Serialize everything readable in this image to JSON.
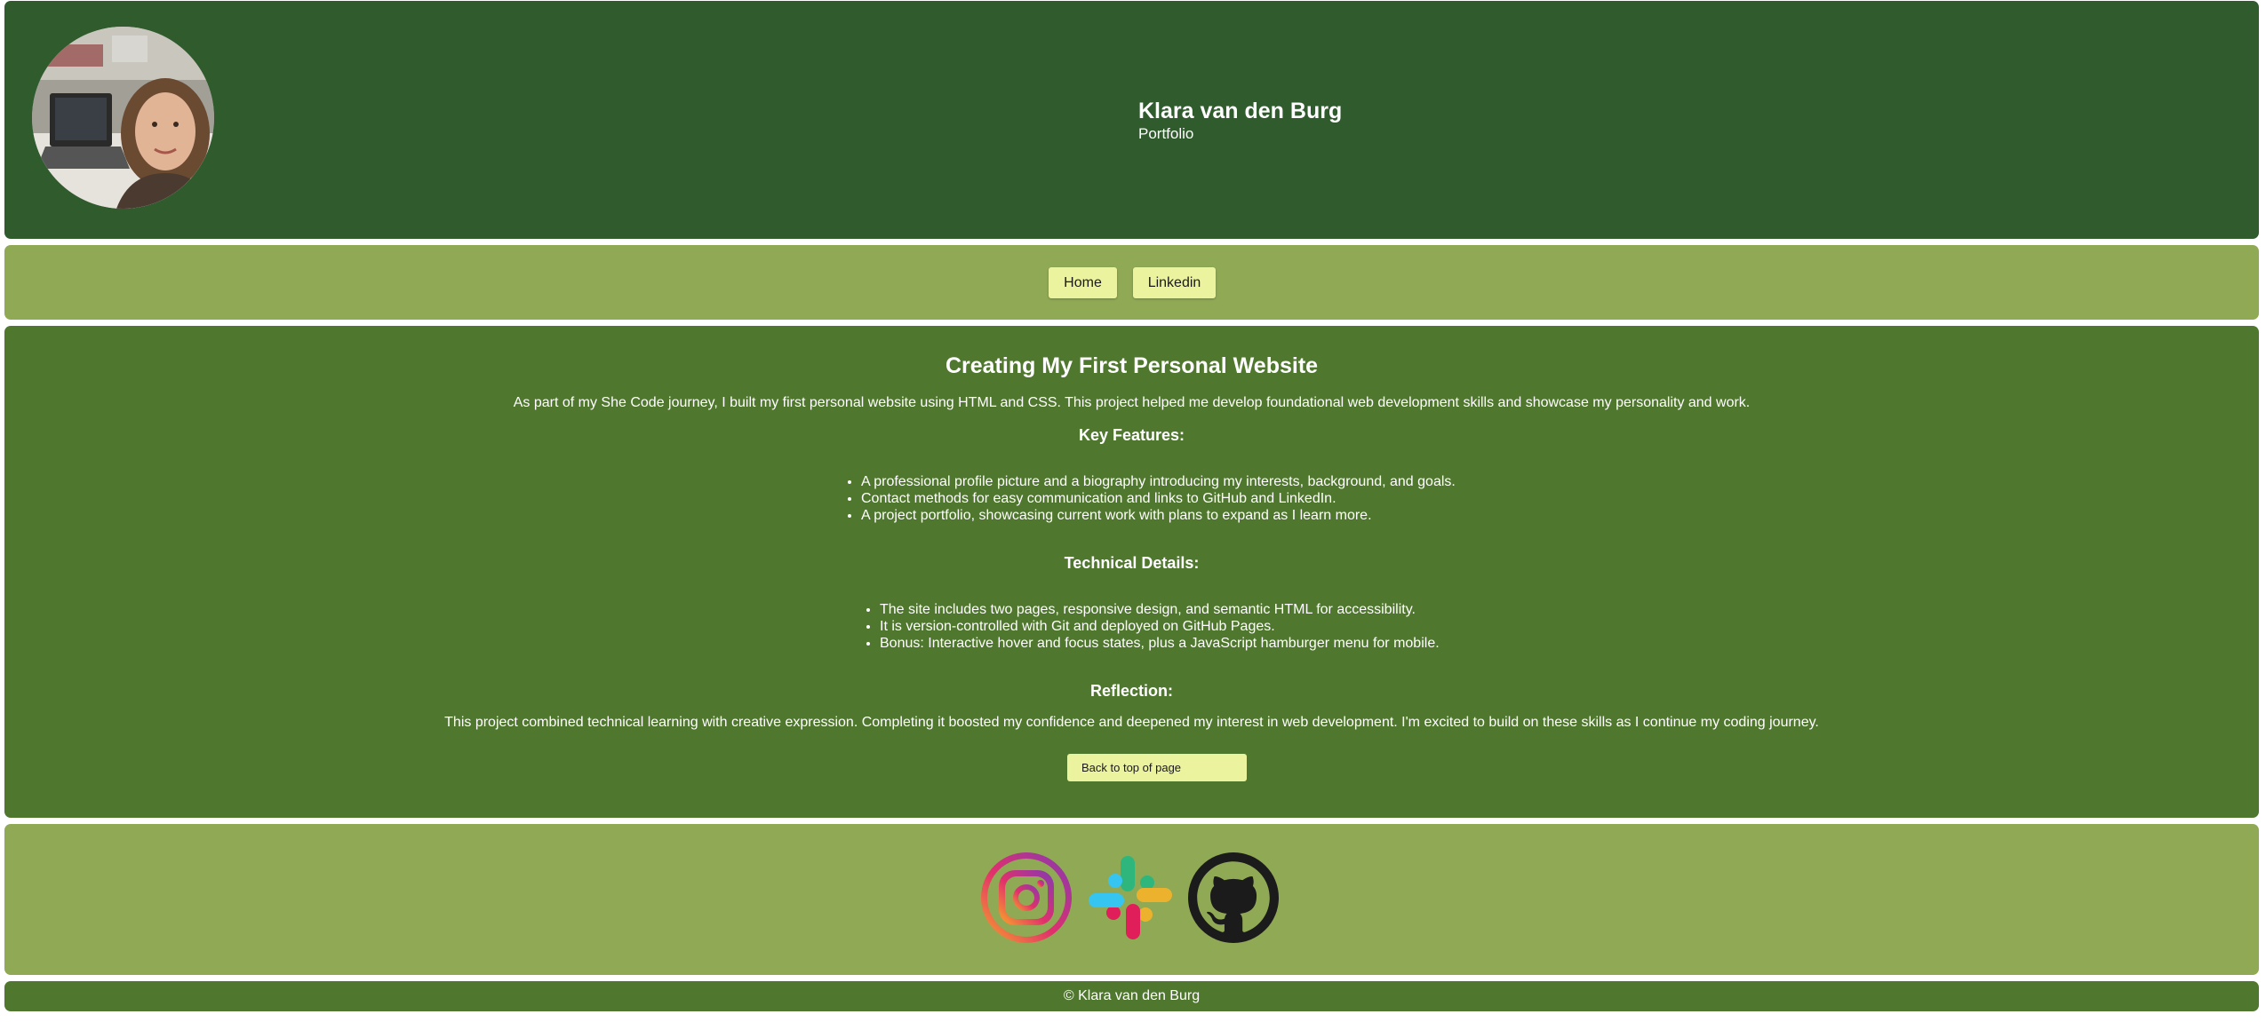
{
  "header": {
    "avatar_alt": "Profile picture",
    "name": "Klara van den Burg",
    "subtitle": "Portfolio"
  },
  "nav": {
    "items": [
      {
        "label": "Home"
      },
      {
        "label": "Linkedin"
      }
    ]
  },
  "main": {
    "title": "Creating My First Personal Website",
    "intro": "As part of my She Code journey, I built my first personal website using HTML and CSS. This project helped me develop foundational web development skills and showcase my personality and work.",
    "key_features": {
      "heading": "Key Features:",
      "items": [
        "A professional profile picture and a biography introducing my interests, background, and goals.",
        "Contact methods for easy communication and links to GitHub and LinkedIn.",
        "A project portfolio, showcasing current work with plans to expand as I learn more."
      ]
    },
    "technical_details": {
      "heading": "Technical Details:",
      "items": [
        "The site includes two pages, responsive design, and semantic HTML for accessibility.",
        "It is version-controlled with Git and deployed on GitHub Pages.",
        "Bonus: Interactive hover and focus states, plus a JavaScript hamburger menu for mobile."
      ]
    },
    "reflection": {
      "heading": "Reflection:",
      "text": "This project combined technical learning with creative expression. Completing it boosted my confidence and deepened my interest in web development. I'm excited to build on these skills as I continue my coding journey."
    },
    "back_button": "Back to top of page"
  },
  "social": {
    "icons": [
      {
        "name": "instagram-icon"
      },
      {
        "name": "slack-icon"
      },
      {
        "name": "github-icon"
      }
    ]
  },
  "footer": {
    "text": "© Klara van den Burg"
  },
  "colors": {
    "header_bg": "#2f5b2d",
    "nav_bg": "#90a955",
    "main_bg": "#4f772d",
    "button_bg": "#ecf39e"
  }
}
